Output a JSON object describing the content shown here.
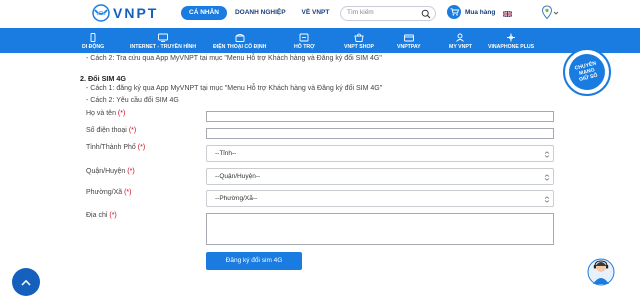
{
  "brand": {
    "name": "VNPT"
  },
  "top_nav": {
    "items": [
      "CÁ NHÂN",
      "DOANH NGHIỆP",
      "VỀ VNPT"
    ],
    "active_index": 0
  },
  "search": {
    "placeholder": "Tìm kiếm"
  },
  "cart": {
    "label": "Mua hàng"
  },
  "main_nav": {
    "items": [
      {
        "label": "DI ĐỘNG",
        "icon": "mobile-icon"
      },
      {
        "label": "INTERNET - TRUYỀN HÌNH",
        "icon": "internet-tv-icon"
      },
      {
        "label": "ĐIỆN THOẠI CỐ ĐỊNH",
        "icon": "landline-phone-icon"
      },
      {
        "label": "HỖ TRỢ",
        "icon": "support-icon"
      },
      {
        "label": "VNPT SHOP",
        "icon": "shop-icon"
      },
      {
        "label": "VNPTPAY",
        "icon": "pay-icon"
      },
      {
        "label": "MY VNPT",
        "icon": "account-icon"
      },
      {
        "label": "VINAPHONE PLUS",
        "icon": "plus-icon"
      }
    ]
  },
  "content": {
    "line_top": "- Cách 2: Tra cứu qua App MyVNPT tại mục \"Menu Hỗ trợ Khách hàng và Đăng ký đổi SIM 4G\"",
    "section_title": "2. Đổi SIM 4G",
    "way1": "- Cách 1: đăng ký qua App MyVNPT tại mục \"Menu Hỗ trợ Khách hàng và Đăng ký đổi SIM 4G\"",
    "way2": "- Cách 2: Yêu cầu đổi SIM 4G"
  },
  "form": {
    "name_label": "Họ và tên",
    "phone_label": "Số điện thoại",
    "province_label": "Tỉnh/Thành Phố",
    "district_label": "Quận/Huyện",
    "ward_label": "Phường/Xã",
    "address_label": "Địa chỉ",
    "required_mark": "(*)",
    "province_value": "--Tỉnh--",
    "district_value": "--Quận/Huyện--",
    "ward_value": "--Phường/Xã--",
    "submit_label": "Đăng ký đổi sim 4G"
  },
  "promo_badge": {
    "line1": "CHUYỂN",
    "line2": "MẠNG",
    "line3": "GIỮ SỐ"
  },
  "colors": {
    "primary": "#1a7ce0",
    "dark_blue": "#1560bd",
    "required": "#d0021b"
  }
}
